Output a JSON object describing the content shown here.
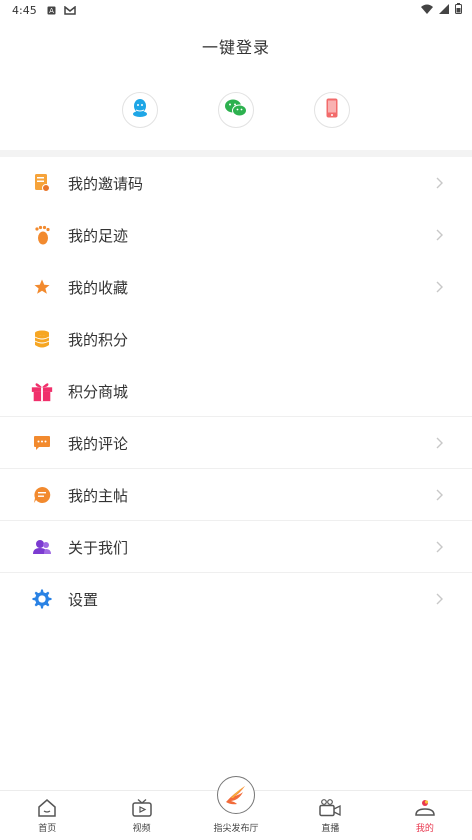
{
  "status_bar": {
    "time": "4:45"
  },
  "login": {
    "title": "一键登录"
  },
  "menu": [
    {
      "label": "我的邀请码"
    },
    {
      "label": "我的足迹"
    },
    {
      "label": "我的收藏"
    },
    {
      "label": "我的积分"
    },
    {
      "label": "积分商城"
    },
    {
      "label": "我的评论"
    },
    {
      "label": "我的主帖"
    },
    {
      "label": "关于我们"
    },
    {
      "label": "设置"
    }
  ],
  "bottom_nav": [
    {
      "label": "首页"
    },
    {
      "label": "视频"
    },
    {
      "label": "指尖发布厅"
    },
    {
      "label": "直播"
    },
    {
      "label": "我的"
    }
  ],
  "colors": {
    "accent_red": "#e8384f",
    "orange": "#f28a2e",
    "qq_blue": "#1ea6e6",
    "wechat_green": "#2db14f",
    "phone_red": "#f26b6b",
    "settings_blue": "#2a82e4",
    "purple": "#7c3bd1"
  }
}
